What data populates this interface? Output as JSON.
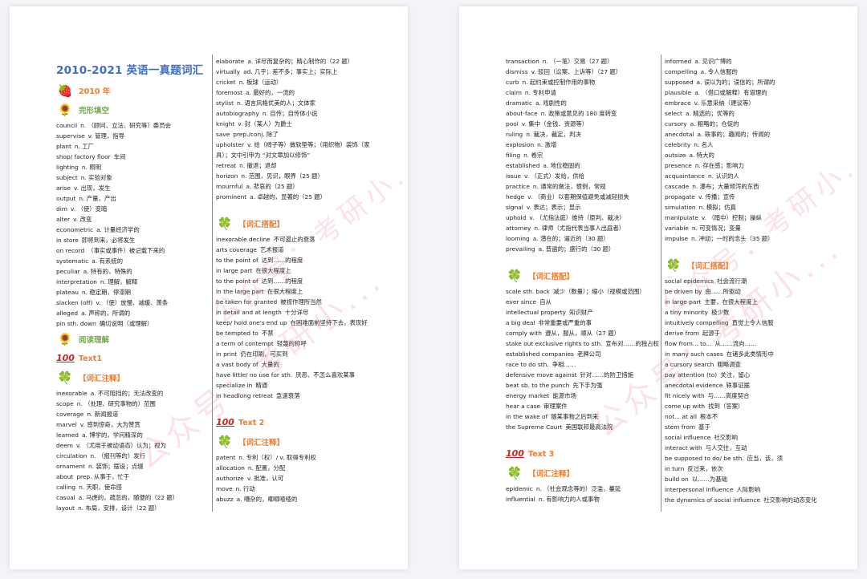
{
  "watermark": "公众号：考研小...",
  "left_page": {
    "title": "2010-2021 英语一真题词汇",
    "year_heading": "2010 年",
    "section_cloze": "完形填空",
    "cloze_entries": [
      {
        "en": "council",
        "zh": "n. （顾问、立法、研究等）委员会"
      },
      {
        "en": "supervise",
        "zh": "v. 管理，指导"
      },
      {
        "en": "plant",
        "zh": "n. 工厂"
      },
      {
        "en": "shop/ factory floor",
        "zh": "车间"
      },
      {
        "en": "lighting",
        "zh": "n. 照明"
      },
      {
        "en": "subject",
        "zh": "n. 实验对象"
      },
      {
        "en": "arise",
        "zh": "v. 出现，发生"
      },
      {
        "en": "output",
        "zh": "n. 产量，产出"
      },
      {
        "en": "dim",
        "zh": "v. （使）变暗"
      },
      {
        "en": "alter",
        "zh": "v. 改变"
      },
      {
        "en": "econometric",
        "zh": "a. 计量经济学的"
      },
      {
        "en": "in store",
        "zh": "即将到来，必将发生"
      },
      {
        "en": "on record",
        "zh": "（事实或事件）被记载下来的"
      },
      {
        "en": "systematic",
        "zh": "a. 有系统的"
      },
      {
        "en": "peculiar",
        "zh": "a. 特有的，特殊的"
      },
      {
        "en": "interpretation",
        "zh": "n. 理解，解释"
      },
      {
        "en": "plateau",
        "zh": "n. 稳定期，停滞期"
      },
      {
        "en": "slacken (off)",
        "zh": "v. （使）放慢、减缓、萧条"
      },
      {
        "en": "alleged",
        "zh": "a. 声称的，所谓的"
      },
      {
        "en": "pin sth. down",
        "zh": "确切说明（或理解）"
      }
    ],
    "section_reading": "阅读理解",
    "text1_heading": "Text1",
    "vocab_notes_heading": "【词汇注释】",
    "text1_notes": [
      {
        "en": "inexorable",
        "zh": "a. 不可阻挡的；无法改变的"
      },
      {
        "en": "scope",
        "zh": "n. （处理、研究事物的）范围"
      },
      {
        "en": "coverage",
        "zh": "n. 新闻报道"
      },
      {
        "en": "marvel",
        "zh": "v. 感到惊奇，大为赞赏"
      },
      {
        "en": "learned",
        "zh": "a. 博学的，学问精深的"
      },
      {
        "en": "deem",
        "zh": "v. （尤用于被动语态）认为；视为"
      },
      {
        "en": "circulation",
        "zh": "n. （报刊等的）发行"
      },
      {
        "en": "ornament",
        "zh": "n. 装饰；摆设；点缀"
      },
      {
        "en": "about",
        "zh": "prep. 从事于，忙于"
      },
      {
        "en": "calling",
        "zh": "n. 天职，使命感"
      },
      {
        "en": "casual",
        "zh": "a. 马虎的，疏忽的，随便的（22 题）"
      },
      {
        "en": "layout",
        "zh": "n. 布局，安排，设计（22 题）"
      }
    ],
    "col2_entries": [
      {
        "en": "elaborate",
        "zh": "a. 详尽而复杂的；精心制作的（22 题）"
      },
      {
        "en": "virtually",
        "zh": "ad. 几乎；差不多；事实上；实际上"
      },
      {
        "en": "cricket",
        "zh": "n. 板球（运动）"
      },
      {
        "en": "foremost",
        "zh": "a. 最好的，一流的"
      },
      {
        "en": "stylist",
        "zh": "n. 语言风格优美的人；文体家"
      },
      {
        "en": "autobiography",
        "zh": "n. 自传；自传体小说"
      },
      {
        "en": "knight",
        "zh": "v. 封（某人）为爵士"
      },
      {
        "en": "save",
        "zh": "prep./conj. 除了"
      },
      {
        "en": "upholster",
        "zh": "v. 给（椅子等）做软垫等；（用织物）装饰（家具）；文中引申为 “对文章加以修饰”"
      },
      {
        "en": "retreat",
        "zh": "n. 撤退；退却"
      },
      {
        "en": "horizon",
        "zh": "n. 范围，见识，眼界（25 题）"
      },
      {
        "en": "mournful",
        "zh": "a. 悲哀的（25 题）"
      },
      {
        "en": "prominent",
        "zh": "a. 卓越的，显著的（25 题）"
      }
    ],
    "collocations_heading": "【词汇搭配】",
    "text1_collocations": [
      {
        "en": "inexorable decline",
        "zh": "不可遏止的衰落"
      },
      {
        "en": "arts coverage",
        "zh": "艺术报道"
      },
      {
        "en": "to the point of",
        "zh": "达到……的程度"
      },
      {
        "en": "in large part",
        "zh": "在很大程度上"
      },
      {
        "en": "to the point of",
        "zh": "达到……的程度"
      },
      {
        "en": "in the large part",
        "zh": "在很大程度上"
      },
      {
        "en": "be taken for granted",
        "zh": "被视作理所当然"
      },
      {
        "en": "in detail and at length",
        "zh": "十分详尽"
      },
      {
        "en": "keep/ hold one's end up",
        "zh": "在困难面前坚持下去，表现好"
      },
      {
        "en": "be tempted to",
        "zh": "不禁"
      },
      {
        "en": "a term of contempt",
        "zh": "轻蔑的称呼"
      },
      {
        "en": "in print",
        "zh": "仍在印刷，可买到"
      },
      {
        "en": "a vast body of",
        "zh": "大量的"
      },
      {
        "en": "have little/ no use for sth.",
        "zh": "厌恶、不怎么喜欢某事"
      },
      {
        "en": "specialize in",
        "zh": "精通"
      },
      {
        "en": "in headlong retreat",
        "zh": "急速衰落"
      }
    ],
    "text2_heading": "Text 2",
    "text2_notes": [
      {
        "en": "patent",
        "zh": "n. 专利（权）/ v. 取得专利权"
      },
      {
        "en": "allocation",
        "zh": "n. 配置，分配"
      },
      {
        "en": "authorize",
        "zh": "v. 批准，认可"
      },
      {
        "en": "move",
        "zh": "n. 行动"
      },
      {
        "en": "abuzz",
        "zh": "a. 嘈杂的，唧唧喳喳的"
      }
    ]
  },
  "right_page": {
    "col1_entries": [
      {
        "en": "transaction",
        "zh": "n. （一笔）交易（27 题）"
      },
      {
        "en": "dismiss",
        "zh": "v. 驳回（讼案、上诉等）（27 题）"
      },
      {
        "en": "curb",
        "zh": "n. 起约束或控制作用的事物"
      },
      {
        "en": "claim",
        "zh": "n. 专利申请"
      },
      {
        "en": "dramatic",
        "zh": "a. 戏剧性的"
      },
      {
        "en": "about-face",
        "zh": "n. 政策或意见的 180 度转变"
      },
      {
        "en": "pool",
        "zh": "v. 集中（金钱、资源等）"
      },
      {
        "en": "ruling",
        "zh": "n. 裁决，裁定，判决"
      },
      {
        "en": "explosion",
        "zh": "n. 激增"
      },
      {
        "en": "filing",
        "zh": "n. 卷宗"
      },
      {
        "en": "established",
        "zh": "a. 地位稳固的"
      },
      {
        "en": "issue",
        "zh": "v. （正式）发给，供给"
      },
      {
        "en": "practice",
        "zh": "n. 通常的做法，惯例，常规"
      },
      {
        "en": "hedge",
        "zh": "v. （商业）以套期保值避免或减轻损失"
      },
      {
        "en": "signal",
        "zh": "v. 表达；表示；显示"
      },
      {
        "en": "uphold",
        "zh": "v. （尤指法庭）维持（原判、裁决）"
      },
      {
        "en": "attorney",
        "zh": "n. 律师（尤指代表当事人出庭者）"
      },
      {
        "en": "looming",
        "zh": "a. 潜在的；逼近的（30 题）"
      },
      {
        "en": "prevailing",
        "zh": "a. 普遍的；盛行的（30 题）"
      }
    ],
    "collocations_heading": "【词汇搭配】",
    "text2_collocations": [
      {
        "en": "scale sth. back",
        "zh": "减少（数量）；缩小（规模或范围）"
      },
      {
        "en": "ever since",
        "zh": "自从"
      },
      {
        "en": "intellectual property",
        "zh": "知识财产"
      },
      {
        "en": "a big deal",
        "zh": "非常重要或严重的事"
      },
      {
        "en": "comply with",
        "zh": "遵从，服从，顺从（27 题）"
      },
      {
        "en": "stake out exclusive rights to sth.",
        "zh": "宣布对……的独占权"
      },
      {
        "en": "established companies",
        "zh": "老牌公司"
      },
      {
        "en": "race to do sth.",
        "zh": "争相……"
      },
      {
        "en": "defensive move against",
        "zh": "针对……的防卫措施"
      },
      {
        "en": "beat sb. to the punch",
        "zh": "先下手为强"
      },
      {
        "en": "energy market",
        "zh": "能源市场"
      },
      {
        "en": "hear a case",
        "zh": "审理案件"
      },
      {
        "en": "in the wake of",
        "zh": "随某事物之后到来"
      },
      {
        "en": "the Supreme Court",
        "zh": "美国联邦最高法院"
      }
    ],
    "text3_heading": "Text 3",
    "vocab_notes_heading": "【词汇注释】",
    "text3_notes": [
      {
        "en": "epidemic",
        "zh": "n. （社会观念等的）泛滥，蔓延"
      },
      {
        "en": "influential",
        "zh": "n. 有影响力的人或事物"
      }
    ],
    "col2_entries": [
      {
        "en": "informed",
        "zh": "a. 见识广博的"
      },
      {
        "en": "compelling",
        "zh": "a. 令人信服的"
      },
      {
        "en": "supposed",
        "zh": "a. 误以为的；误信的；所谓的"
      },
      {
        "en": "plausible",
        "zh": "a. （借口或解释）有道理的"
      },
      {
        "en": "embrace",
        "zh": "v. 乐意采纳（建议等）"
      },
      {
        "en": "select",
        "zh": "a. 精选的；优等的"
      },
      {
        "en": "cursory",
        "zh": "a. 粗略的；仓促的"
      },
      {
        "en": "anecdotal",
        "zh": "a. 轶事的；趣闻的；传闻的"
      },
      {
        "en": "celebrity",
        "zh": "n. 名人"
      },
      {
        "en": "outsize",
        "zh": "a. 特大的"
      },
      {
        "en": "presence",
        "zh": "n. 存在感；影响力"
      },
      {
        "en": "acquaintance",
        "zh": "n. 认识的人"
      },
      {
        "en": "cascade",
        "zh": "n. 瀑布；大量倾泻的东西"
      },
      {
        "en": "propagate",
        "zh": "v. 传播；宣传"
      },
      {
        "en": "simulation",
        "zh": "n. 模拟；仿真"
      },
      {
        "en": "manipulate",
        "zh": "v. （暗中）控制；操纵"
      },
      {
        "en": "variable",
        "zh": "n. 可变情况；变量"
      },
      {
        "en": "impulse",
        "zh": "n. 冲动；一时的念头（35 题）"
      }
    ],
    "text3_collocations": [
      {
        "en": "social epidemics",
        "zh": "社会流行潮"
      },
      {
        "en": "be driven by",
        "zh": "由……所驱动"
      },
      {
        "en": "in large part",
        "zh": "主要，在很大程度上"
      },
      {
        "en": "a tiny minority",
        "zh": "极少数"
      },
      {
        "en": "intuitively compelling",
        "zh": "直觉上令人信服"
      },
      {
        "en": "derive from",
        "zh": "起源于"
      },
      {
        "en": "flow from... to...",
        "zh": "从……流向……"
      },
      {
        "en": "in many such cases",
        "zh": "在诸多此类情形中"
      },
      {
        "en": "a cursory search",
        "zh": "粗略调查"
      },
      {
        "en": "pay attention (to)",
        "zh": "关注，留心"
      },
      {
        "en": "anecdotal evidence",
        "zh": "轶事证据"
      },
      {
        "en": "fit nicely with",
        "zh": "与……高度契合"
      },
      {
        "en": "come up with",
        "zh": "找到（答案）"
      },
      {
        "en": "not... at all",
        "zh": "根本不"
      },
      {
        "en": "stem from",
        "zh": "基于"
      },
      {
        "en": "social influence",
        "zh": "社交影响"
      },
      {
        "en": "interact with",
        "zh": "与人交往，互动"
      },
      {
        "en": "be supposed to do/ be sth.",
        "zh": "应当，该，须"
      },
      {
        "en": "in turn",
        "zh": "反过来，依次"
      },
      {
        "en": "build on",
        "zh": "以……为基础"
      },
      {
        "en": "interpersonal influence",
        "zh": "人际影响"
      },
      {
        "en": "the dynamics of social influence",
        "zh": "社交影响的动态变化"
      }
    ]
  },
  "icons": {
    "strawberry": "🍓",
    "sunflower": "🌻",
    "hundred": "100",
    "clover": "🍀"
  }
}
